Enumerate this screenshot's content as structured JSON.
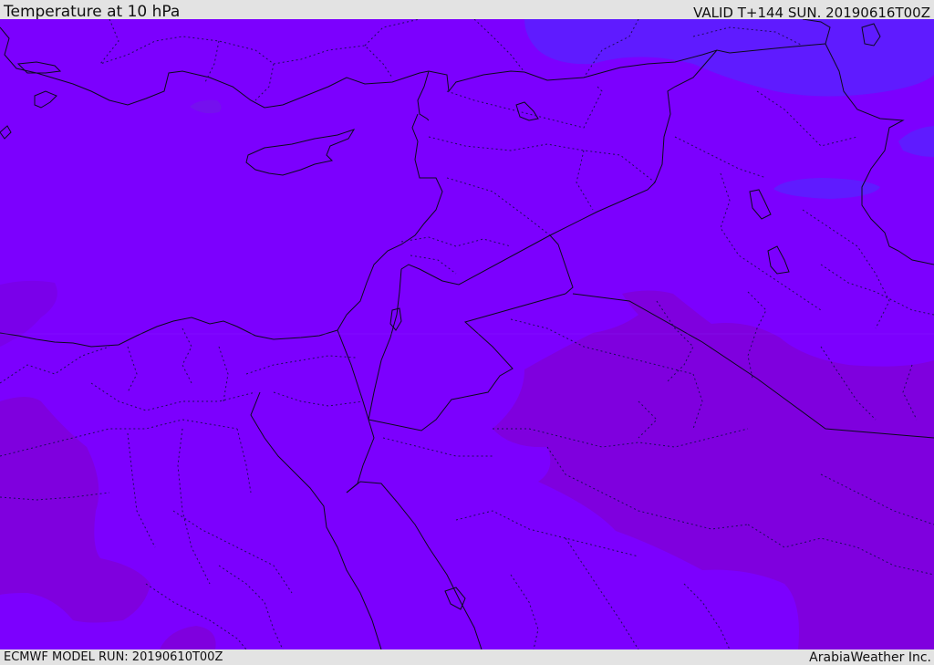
{
  "header": {
    "title": "Temperature at 10 hPa",
    "valid": "VALID T+144 SUN. 20190616T00Z"
  },
  "footer": {
    "model_run": "ECMWF MODEL RUN: 20190610T00Z",
    "credit": "ArabiaWeather Inc."
  },
  "colors": {
    "base_field": "#7c00fe",
    "cooler_field": "#5f1bff",
    "cool_patch": "#6d16ff",
    "warmer_field": "#7f00de",
    "warm_patch": "#7a00ea",
    "borders": "#0b0b1c",
    "internal_boundaries": "#1c0c5a"
  }
}
